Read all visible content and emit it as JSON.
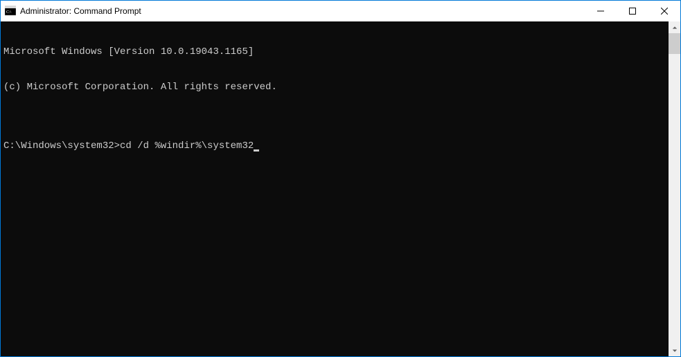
{
  "window": {
    "title": "Administrator: Command Prompt"
  },
  "terminal": {
    "lines": [
      "Microsoft Windows [Version 10.0.19043.1165]",
      "(c) Microsoft Corporation. All rights reserved.",
      ""
    ],
    "prompt": "C:\\Windows\\system32>",
    "command": "cd /d %windir%\\system32"
  }
}
